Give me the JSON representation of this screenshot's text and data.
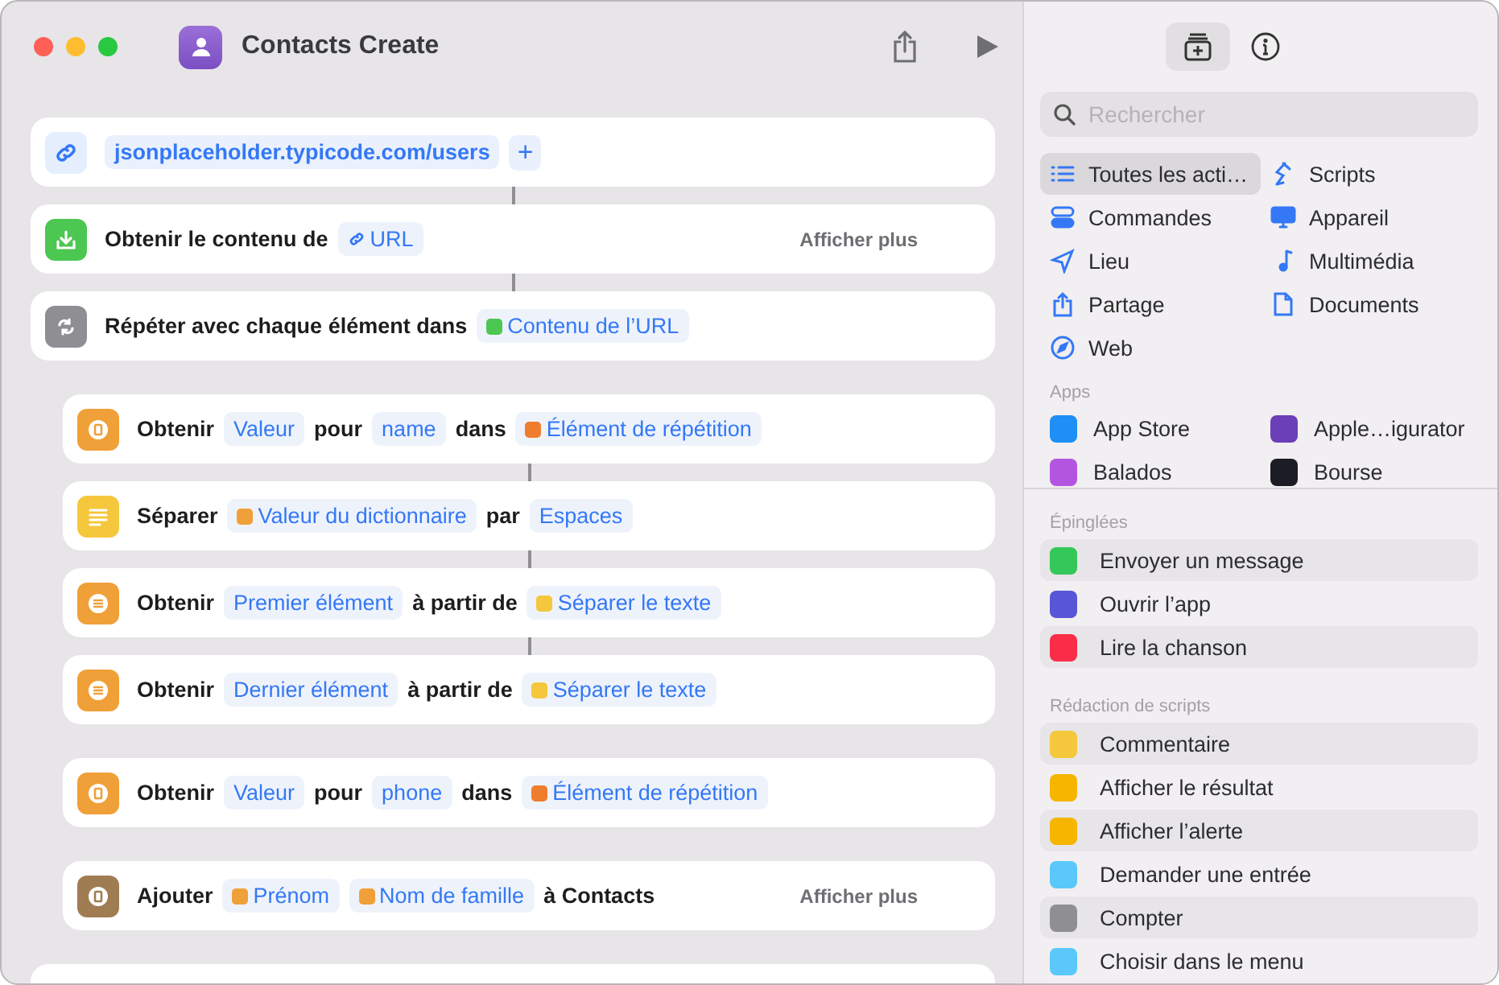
{
  "window": {
    "title": "Contacts Create"
  },
  "actions": [
    {
      "kind": "url",
      "value": "jsonplaceholder.typicode.com/users",
      "add_label": "+"
    },
    {
      "kind": "step",
      "color": "#4cc752",
      "connected": true,
      "parts": [
        {
          "kind": "text",
          "text": "Obtenir le contenu de"
        },
        {
          "kind": "link",
          "text": "URL"
        }
      ],
      "more": "Afficher plus"
    },
    {
      "kind": "step",
      "color": "#8e8e93",
      "connected": true,
      "parts": [
        {
          "kind": "text",
          "text": "Répéter avec chaque élément dans"
        },
        {
          "kind": "variable",
          "color": "#4cc752",
          "text": "Contenu de l’URL"
        }
      ],
      "children": [
        {
          "kind": "step",
          "color": "#f0a038",
          "connected": false,
          "parts": [
            {
              "kind": "text",
              "text": "Obtenir"
            },
            {
              "kind": "parameter",
              "text": "Valeur"
            },
            {
              "kind": "text",
              "text": "pour"
            },
            {
              "kind": "parameter",
              "text": "name"
            },
            {
              "kind": "text",
              "text": "dans"
            },
            {
              "kind": "variable",
              "color": "#ef7d2e",
              "text": "Élément de répétition"
            }
          ]
        },
        {
          "kind": "step",
          "color": "#f5c73d",
          "connected": true,
          "parts": [
            {
              "kind": "text",
              "text": "Séparer"
            },
            {
              "kind": "variable",
              "color": "#f0a038",
              "text": "Valeur du dictionnaire"
            },
            {
              "kind": "text",
              "text": "par"
            },
            {
              "kind": "parameter",
              "text": "Espaces"
            }
          ]
        },
        {
          "kind": "step",
          "color": "#f0a038",
          "connected": true,
          "parts": [
            {
              "kind": "text",
              "text": "Obtenir"
            },
            {
              "kind": "parameter",
              "text": "Premier élément"
            },
            {
              "kind": "text",
              "text": "à partir de"
            },
            {
              "kind": "variable",
              "color": "#f5c73d",
              "text": "Séparer le texte"
            }
          ]
        },
        {
          "kind": "step",
          "color": "#f0a038",
          "connected": true,
          "parts": [
            {
              "kind": "text",
              "text": "Obtenir"
            },
            {
              "kind": "parameter",
              "text": "Dernier élément"
            },
            {
              "kind": "text",
              "text": "à partir de"
            },
            {
              "kind": "variable",
              "color": "#f5c73d",
              "text": "Séparer le texte"
            }
          ]
        },
        {
          "kind": "step",
          "color": "#f0a038",
          "connected": false,
          "parts": [
            {
              "kind": "text",
              "text": "Obtenir"
            },
            {
              "kind": "parameter",
              "text": "Valeur"
            },
            {
              "kind": "text",
              "text": "pour"
            },
            {
              "kind": "parameter",
              "text": "phone"
            },
            {
              "kind": "text",
              "text": "dans"
            },
            {
              "kind": "variable",
              "color": "#ef7d2e",
              "text": "Élément de répétition"
            }
          ]
        },
        {
          "kind": "step",
          "color": "#a07c52",
          "connected": false,
          "parts": [
            {
              "kind": "text",
              "text": "Ajouter"
            },
            {
              "kind": "variable",
              "color": "#f0a038",
              "text": "Prénom"
            },
            {
              "kind": "variable",
              "color": "#f0a038",
              "text": "Nom de famille"
            },
            {
              "kind": "text",
              "text": "à Contacts"
            }
          ],
          "more": "Afficher plus"
        }
      ]
    }
  ],
  "toolbar": [
    {
      "selected": true
    },
    {
      "selected": false
    }
  ],
  "search": {
    "placeholder": "Rechercher"
  },
  "categories": [
    {
      "label": "Toutes les acti…",
      "selected": true
    },
    {
      "label": "Scripts",
      "selected": false
    },
    {
      "label": "Commandes",
      "selected": false
    },
    {
      "label": "Appareil",
      "selected": false
    },
    {
      "label": "Lieu",
      "selected": false
    },
    {
      "label": "Multimédia",
      "selected": false
    },
    {
      "label": "Partage",
      "selected": false
    },
    {
      "label": "Documents",
      "selected": false
    },
    {
      "label": "Web",
      "selected": false
    }
  ],
  "apps": {
    "heading": "Apps",
    "items": [
      {
        "label": "App Store",
        "color": "#1e8ff5"
      },
      {
        "label": "Apple…igurator",
        "color": "#6a3fb8"
      },
      {
        "label": "Balados",
        "color": "#b455e0"
      },
      {
        "label": "Bourse",
        "color": "#1c1c24"
      }
    ]
  },
  "pinned": {
    "heading": "Épinglées",
    "items": [
      {
        "label": "Envoyer un message",
        "color": "#34c759"
      },
      {
        "label": "Ouvrir l’app",
        "color": "#5856d6"
      },
      {
        "label": "Lire la chanson",
        "color": "#fa2d48"
      }
    ]
  },
  "scripting": {
    "heading": "Rédaction de scripts",
    "items": [
      {
        "label": "Commentaire",
        "color": "#f5c73d"
      },
      {
        "label": "Afficher le résultat",
        "color": "#f7b500"
      },
      {
        "label": "Afficher l’alerte",
        "color": "#f7b500"
      },
      {
        "label": "Demander une entrée",
        "color": "#5ac8fa"
      },
      {
        "label": "Compter",
        "color": "#8e8e93"
      },
      {
        "label": "Choisir dans le menu",
        "color": "#5ac8fa"
      }
    ]
  }
}
